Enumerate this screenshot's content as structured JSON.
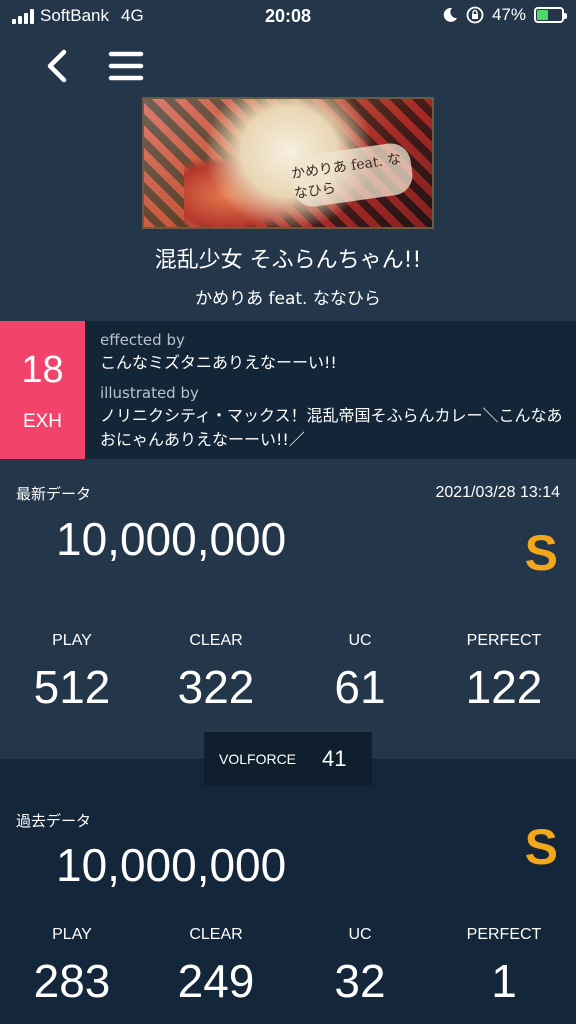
{
  "status_bar": {
    "carrier": "SoftBank",
    "network": "4G",
    "time": "20:08",
    "battery": "47%"
  },
  "nav": {
    "back_icon": "chevron-left-icon",
    "menu_icon": "hamburger-menu-icon"
  },
  "song": {
    "title": "混乱少女 そふらんちゃん!!",
    "artist": "かめりあ feat. ななひら",
    "jacket_logo": "かめりあ feat. ななひら"
  },
  "difficulty": {
    "level": "18",
    "name": "EXH",
    "color": "#f2436b",
    "effected_label": "effected by",
    "effected_value": "こんなミズタニありえなーーい!!",
    "illustrated_label": "illustrated by",
    "illustrated_value": "ノリニクシティ・マックス！混乱帝国そふらんカレー＼こんなあおにゃんありえなーーい!!／"
  },
  "latest": {
    "label": "最新データ",
    "timestamp": "2021/03/28 13:14",
    "score": "10,000,000",
    "grade": "S",
    "stats": [
      {
        "label": "PLAY",
        "value": "512"
      },
      {
        "label": "CLEAR",
        "value": "322"
      },
      {
        "label": "UC",
        "value": "61"
      },
      {
        "label": "PERFECT",
        "value": "122"
      }
    ]
  },
  "volforce": {
    "label": "VOLFORCE",
    "value": "41"
  },
  "past": {
    "label": "過去データ",
    "score": "10,000,000",
    "grade": "S",
    "stats": [
      {
        "label": "PLAY",
        "value": "283"
      },
      {
        "label": "CLEAR",
        "value": "249"
      },
      {
        "label": "UC",
        "value": "32"
      },
      {
        "label": "PERFECT",
        "value": "1"
      }
    ]
  },
  "colors": {
    "background": "#24364a",
    "panel_dark": "#132638",
    "grade": "#f3a71a"
  }
}
